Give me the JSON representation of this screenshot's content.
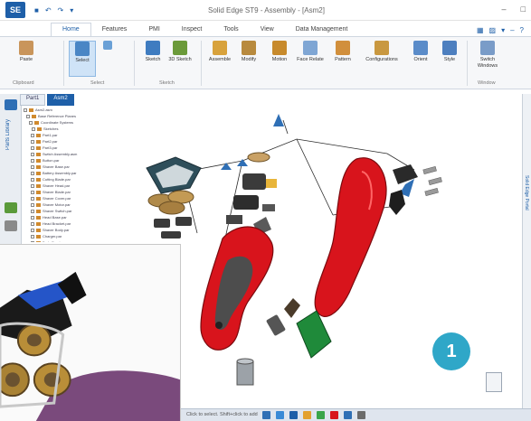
{
  "window": {
    "title": "Solid Edge ST9 - Assembly - [Asm2]"
  },
  "quick_access": [
    "■",
    "↶",
    "↷",
    "▾"
  ],
  "window_controls": [
    "–",
    "□"
  ],
  "ribbon_tabs": [
    "Home",
    "Features",
    "PMI",
    "Inspect",
    "Tools",
    "View",
    "Data Management"
  ],
  "ribbon_right_icons": [
    "▦",
    "▨",
    "▾",
    "–",
    "?"
  ],
  "ribbon": {
    "buttons": [
      "Paste",
      "Select",
      "Sketch",
      "3D Sketch",
      "Assemble",
      "Modify",
      "Motion",
      "Face Relate",
      "Pattern",
      "Configurations",
      "Orient",
      "Style",
      "Switch Windows"
    ],
    "groups": [
      "Clipboard",
      "Select",
      "Sketch",
      "Window"
    ]
  },
  "doc_tabs": [
    "Part1",
    "Asm2"
  ],
  "left_panel": {
    "label": "Parts Library"
  },
  "right_panel": {
    "label": "Solid Edge Portal"
  },
  "tree": {
    "items": [
      "Asm2.asm",
      "Base Reference Planes",
      "Coordinate Systems",
      "Sketches",
      "Part1.par",
      "Part2.par",
      "Part3.par",
      "Switch Assembly.asm",
      "Button.par",
      "Shaver Base.par",
      "Battery Assembly.par",
      "Cutting Blade.par",
      "Shaver Head.par",
      "Shaver Blade.par",
      "Shaver Cover.par",
      "Shaver Motor.par",
      "Shaver Switch.par",
      "Head Base.par",
      "Head Bracket.par",
      "Shaver Body.par",
      "Charger.par",
      "Body Front.par"
    ]
  },
  "badge": "1",
  "taskbar": {
    "label": "Click to select. Shift+click to add"
  },
  "colors": {
    "accent": "#1e5fa8",
    "shaver_red": "#d8141c",
    "badge": "#2fa7c8"
  }
}
